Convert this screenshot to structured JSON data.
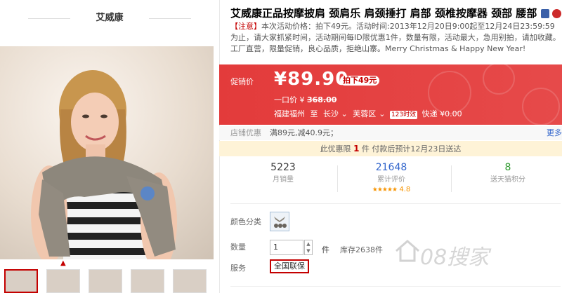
{
  "shop": {
    "name": "艾威康"
  },
  "gallery": {
    "zoom_icon": "magnifier-icon",
    "thumb_count": 5
  },
  "product": {
    "title": "艾威康正品按摩披肩 颈肩乐 肩颈捶打 肩部 颈椎按摩器 颈部 腰部",
    "notice_prefix": "【注意】",
    "notice_body": "本次活动价格：拍下49元。活动时间:2013年12月20日9:00起至12月24日23:59:59为止，请大家抓紧时间，活动期间每ID限优惠1件，数量有限，活动最大，急用别拍，请加收藏。工厂直营，限量促销，良心品质，拒绝山寨。Merry Christmas & Happy New Year!"
  },
  "price": {
    "label": "促销价",
    "value": "¥89.90",
    "discount_tag": "拍下49元",
    "original_label": "一口价",
    "original_currency": "¥",
    "original_value": "368.00",
    "ship_from": "福建福州",
    "ship_to_word": "至",
    "ship_to_city": "长沙",
    "ship_to_district": "芙蓉区",
    "time_badge": "123时效",
    "express": "快递 ¥0.00"
  },
  "promo": {
    "label": "店铺优惠",
    "value": "满89元,减40.9元；",
    "more": "更多"
  },
  "limit": {
    "prefix": "此优惠限",
    "count": "1",
    "suffix": "件  付款后预计12月23日送达"
  },
  "stats": [
    {
      "value": "5223",
      "label": "月销量"
    },
    {
      "value": "21648",
      "label": "累计评价",
      "rating": "4.8",
      "stars": "★★★★★"
    },
    {
      "value": "8",
      "label": "送天猫积分"
    }
  ],
  "attrs": {
    "color_label": "颜色分类",
    "qty_label": "数量",
    "qty_value": "1",
    "qty_unit": "件",
    "stock": "库存2638件",
    "service_label": "服务",
    "service_value": "全国联保"
  },
  "watermark": {
    "text": "08搜家"
  },
  "colors": {
    "accent": "#c40000",
    "price_bg": "#e4393c",
    "limit_bg": "#fef3d7",
    "link": "#3366cc",
    "sales": "#3366cc",
    "points": "#2e9a2e"
  }
}
